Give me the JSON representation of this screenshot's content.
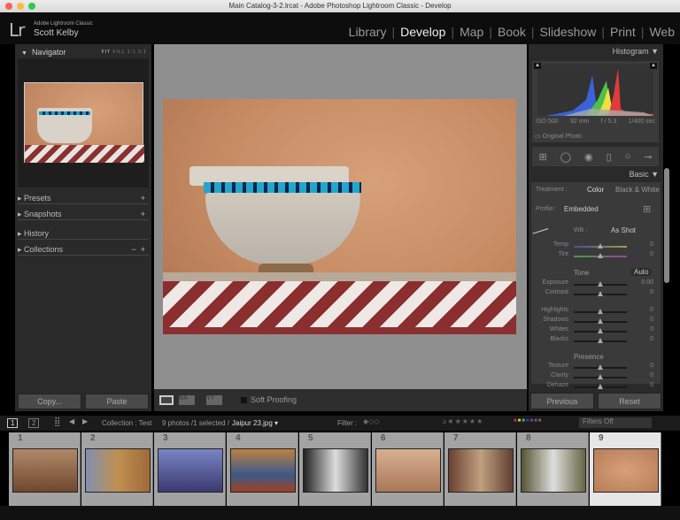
{
  "window": {
    "title": "Main Catalog-3-2.lrcat - Adobe Photoshop Lightroom Classic - Develop"
  },
  "header": {
    "logo": "Lr",
    "product": "Adobe Lightroom Classic",
    "user": "Scott Kelby",
    "modules": [
      {
        "label": "Library"
      },
      {
        "label": "Develop",
        "active": true
      },
      {
        "label": "Map"
      },
      {
        "label": "Book"
      },
      {
        "label": "Slideshow"
      },
      {
        "label": "Print"
      },
      {
        "label": "Web"
      }
    ]
  },
  "left": {
    "navigator": "Navigator",
    "zoom": [
      "FIT",
      "FILL",
      "1:1",
      "3:1"
    ],
    "sections": [
      "Presets",
      "Snapshots",
      "History",
      "Collections"
    ],
    "copy": "Copy...",
    "paste": "Paste"
  },
  "toolbar": {
    "soft_proofing": "Soft Proofing"
  },
  "right": {
    "histogram": "Histogram",
    "iso": "ISO 500",
    "focal": "92 mm",
    "aperture": "f / 5.3",
    "shutter": "1/400 sec",
    "original": "Original Photo",
    "basic": "Basic",
    "treatment_label": "Treatment :",
    "color": "Color",
    "bw": "Black & White",
    "profile_label": "Profile :",
    "profile": "Embedded",
    "wb_label": "WB :",
    "wb": "As Shot",
    "tone": "Tone",
    "auto": "Auto",
    "presence": "Presence",
    "sliders": [
      {
        "label": "Temp",
        "value": "0"
      },
      {
        "label": "Tint",
        "value": "0"
      },
      {
        "label": "Exposure",
        "value": "0.00"
      },
      {
        "label": "Contrast",
        "value": "0"
      },
      {
        "label": "Highlights",
        "value": "0"
      },
      {
        "label": "Shadows",
        "value": "0"
      },
      {
        "label": "Whites",
        "value": "0"
      },
      {
        "label": "Blacks",
        "value": "0"
      },
      {
        "label": "Texture",
        "value": "0"
      },
      {
        "label": "Clarity",
        "value": "0"
      },
      {
        "label": "Dehaze",
        "value": "0"
      }
    ],
    "previous": "Previous",
    "reset": "Reset"
  },
  "filmstrip": {
    "screen1": "1",
    "screen2": "2",
    "source": "Collection : Test",
    "count": "9 photos /1 selected /",
    "selected": "Jaipur 23.jpg",
    "filter_label": "Filter :",
    "filters_off": "Filters Off",
    "thumbs": [
      "1",
      "2",
      "3",
      "4",
      "5",
      "6",
      "7",
      "8",
      "9"
    ],
    "selected_index": 9
  }
}
